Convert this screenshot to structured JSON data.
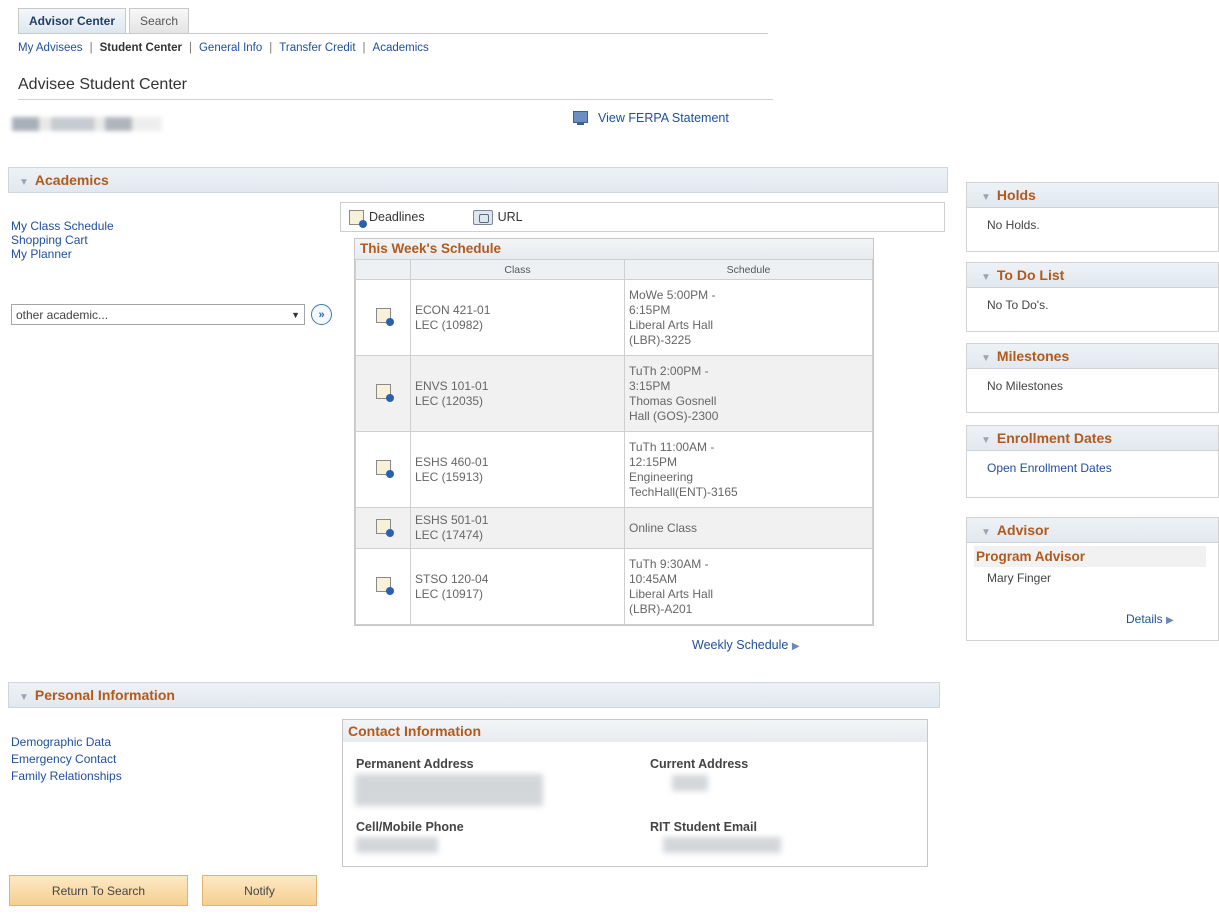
{
  "tabs": [
    {
      "label": "Advisor Center"
    },
    {
      "label": "Search"
    }
  ],
  "subnav": {
    "items": [
      "My Advisees",
      "Student Center",
      "General Info",
      "Transfer Credit",
      "Academics"
    ]
  },
  "page": {
    "title": "Advisee Student Center",
    "ferpa_link": "View FERPA Statement"
  },
  "academics": {
    "section_title": "Academics",
    "links": [
      "My Class Schedule",
      "Shopping Cart",
      "My Planner"
    ],
    "other_select": "other academic...",
    "toolbar": {
      "deadlines": "Deadlines",
      "url": "URL"
    },
    "schedule": {
      "title": "This Week's Schedule",
      "headers": {
        "class": "Class",
        "schedule": "Schedule"
      },
      "rows": [
        {
          "class_line1": "ECON 421-01",
          "class_line2": "LEC (10982)",
          "sched_lines": [
            "MoWe 5:00PM -",
            "6:15PM",
            "Liberal Arts Hall",
            "(LBR)-3225"
          ]
        },
        {
          "class_line1": "ENVS 101-01",
          "class_line2": "LEC (12035)",
          "sched_lines": [
            "TuTh 2:00PM -",
            "3:15PM",
            "Thomas Gosnell",
            "Hall (GOS)-2300"
          ]
        },
        {
          "class_line1": "ESHS 460-01",
          "class_line2": "LEC (15913)",
          "sched_lines": [
            "TuTh 11:00AM -",
            "12:15PM",
            "Engineering",
            "TechHall(ENT)-3165"
          ]
        },
        {
          "class_line1": "ESHS 501-01",
          "class_line2": "LEC (17474)",
          "sched_lines": [
            "Online Class"
          ]
        },
        {
          "class_line1": "STSO 120-04",
          "class_line2": "LEC (10917)",
          "sched_lines": [
            "TuTh 9:30AM -",
            "10:45AM",
            "Liberal Arts Hall",
            "(LBR)-A201"
          ]
        }
      ],
      "weekly_link": "Weekly Schedule"
    }
  },
  "sidebar": {
    "holds": {
      "title": "Holds",
      "text": "No Holds."
    },
    "todo": {
      "title": "To Do List",
      "text": "No To Do's."
    },
    "milestones": {
      "title": "Milestones",
      "text": "No Milestones"
    },
    "enrollment": {
      "title": "Enrollment Dates",
      "link": "Open Enrollment Dates"
    },
    "advisor": {
      "title": "Advisor",
      "subtitle": "Program Advisor",
      "name": "Mary Finger",
      "details": "Details"
    }
  },
  "personal": {
    "section_title": "Personal Information",
    "links": [
      "Demographic Data",
      "Emergency Contact",
      "Family Relationships"
    ],
    "contact": {
      "title": "Contact Information",
      "permanent_address": "Permanent Address",
      "current_address": "Current Address",
      "cell_phone": "Cell/Mobile Phone",
      "student_email": "RIT Student Email"
    }
  },
  "buttons": {
    "return": "Return To Search",
    "notify": "Notify"
  },
  "colors": {
    "section_title": "#b25a1c",
    "link": "#1f4e9d",
    "button_bg": "#f5cf8f"
  }
}
